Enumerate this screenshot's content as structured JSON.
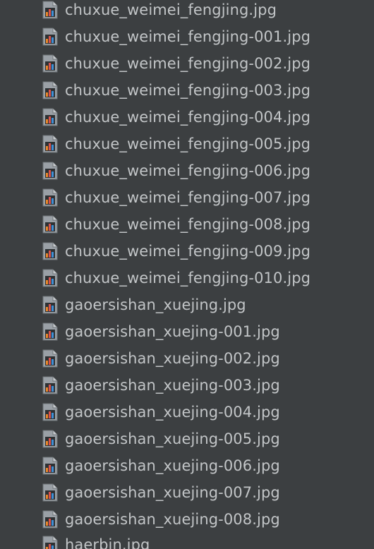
{
  "file_list": {
    "icon": "image-file-icon",
    "items": [
      "chuxue_weimei_fengjing.jpg",
      "chuxue_weimei_fengjing-001.jpg",
      "chuxue_weimei_fengjing-002.jpg",
      "chuxue_weimei_fengjing-003.jpg",
      "chuxue_weimei_fengjing-004.jpg",
      "chuxue_weimei_fengjing-005.jpg",
      "chuxue_weimei_fengjing-006.jpg",
      "chuxue_weimei_fengjing-007.jpg",
      "chuxue_weimei_fengjing-008.jpg",
      "chuxue_weimei_fengjing-009.jpg",
      "chuxue_weimei_fengjing-010.jpg",
      "gaoersishan_xuejing.jpg",
      "gaoersishan_xuejing-001.jpg",
      "gaoersishan_xuejing-002.jpg",
      "gaoersishan_xuejing-003.jpg",
      "gaoersishan_xuejing-004.jpg",
      "gaoersishan_xuejing-005.jpg",
      "gaoersishan_xuejing-006.jpg",
      "gaoersishan_xuejing-007.jpg",
      "gaoersishan_xuejing-008.jpg",
      "haerbin.jpg"
    ]
  },
  "colors": {
    "background": "#3c3f41",
    "text": "#c2c5c7"
  }
}
